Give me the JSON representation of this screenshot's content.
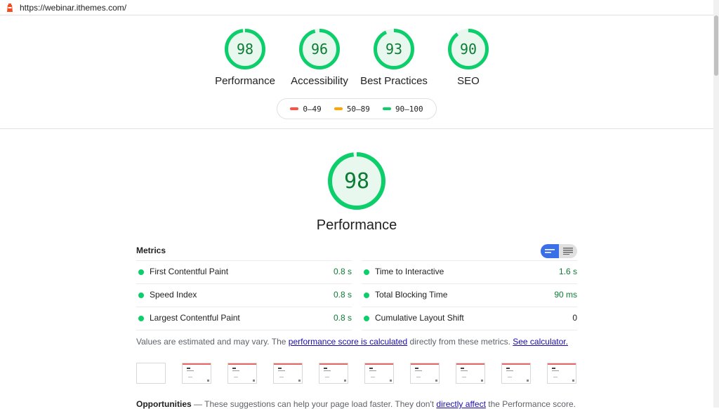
{
  "browser": {
    "url": "https://webinar.ithemes.com/"
  },
  "scores": [
    {
      "label": "Performance",
      "value": 98
    },
    {
      "label": "Accessibility",
      "value": 96
    },
    {
      "label": "Best Practices",
      "value": 93
    },
    {
      "label": "SEO",
      "value": 90
    }
  ],
  "legend": {
    "fail": "0–49",
    "average": "50–89",
    "pass": "90–100"
  },
  "colors": {
    "pass": "#0cce6b",
    "passText": "#0c7c34",
    "passBg": "#e8f8ef",
    "average": "#ffa400",
    "fail": "#ff4e42",
    "accent": "#3b6fe8"
  },
  "performance": {
    "score": 98,
    "title": "Performance"
  },
  "metrics": {
    "title": "Metrics",
    "left": [
      {
        "name": "First Contentful Paint",
        "value": "0.8 s"
      },
      {
        "name": "Speed Index",
        "value": "0.8 s"
      },
      {
        "name": "Largest Contentful Paint",
        "value": "0.8 s"
      }
    ],
    "right": [
      {
        "name": "Time to Interactive",
        "value": "1.6 s"
      },
      {
        "name": "Total Blocking Time",
        "value": "90 ms"
      },
      {
        "name": "Cumulative Layout Shift",
        "value": "0"
      }
    ]
  },
  "note": {
    "prefix": "Values are estimated and may vary. The ",
    "link1": "performance score is calculated",
    "middle": " directly from these metrics. ",
    "link2": "See calculator."
  },
  "opportunities": {
    "title": "Opportunities",
    "prefix": " — These suggestions can help your page load faster. They don't ",
    "link": "directly affect",
    "suffix": " the Performance score."
  },
  "filmstrip": {
    "frames": 10
  },
  "icons": {
    "favicon": "lighthouse-icon",
    "toggle_on": "bars-compact-icon",
    "toggle_off": "lines-expanded-icon"
  }
}
